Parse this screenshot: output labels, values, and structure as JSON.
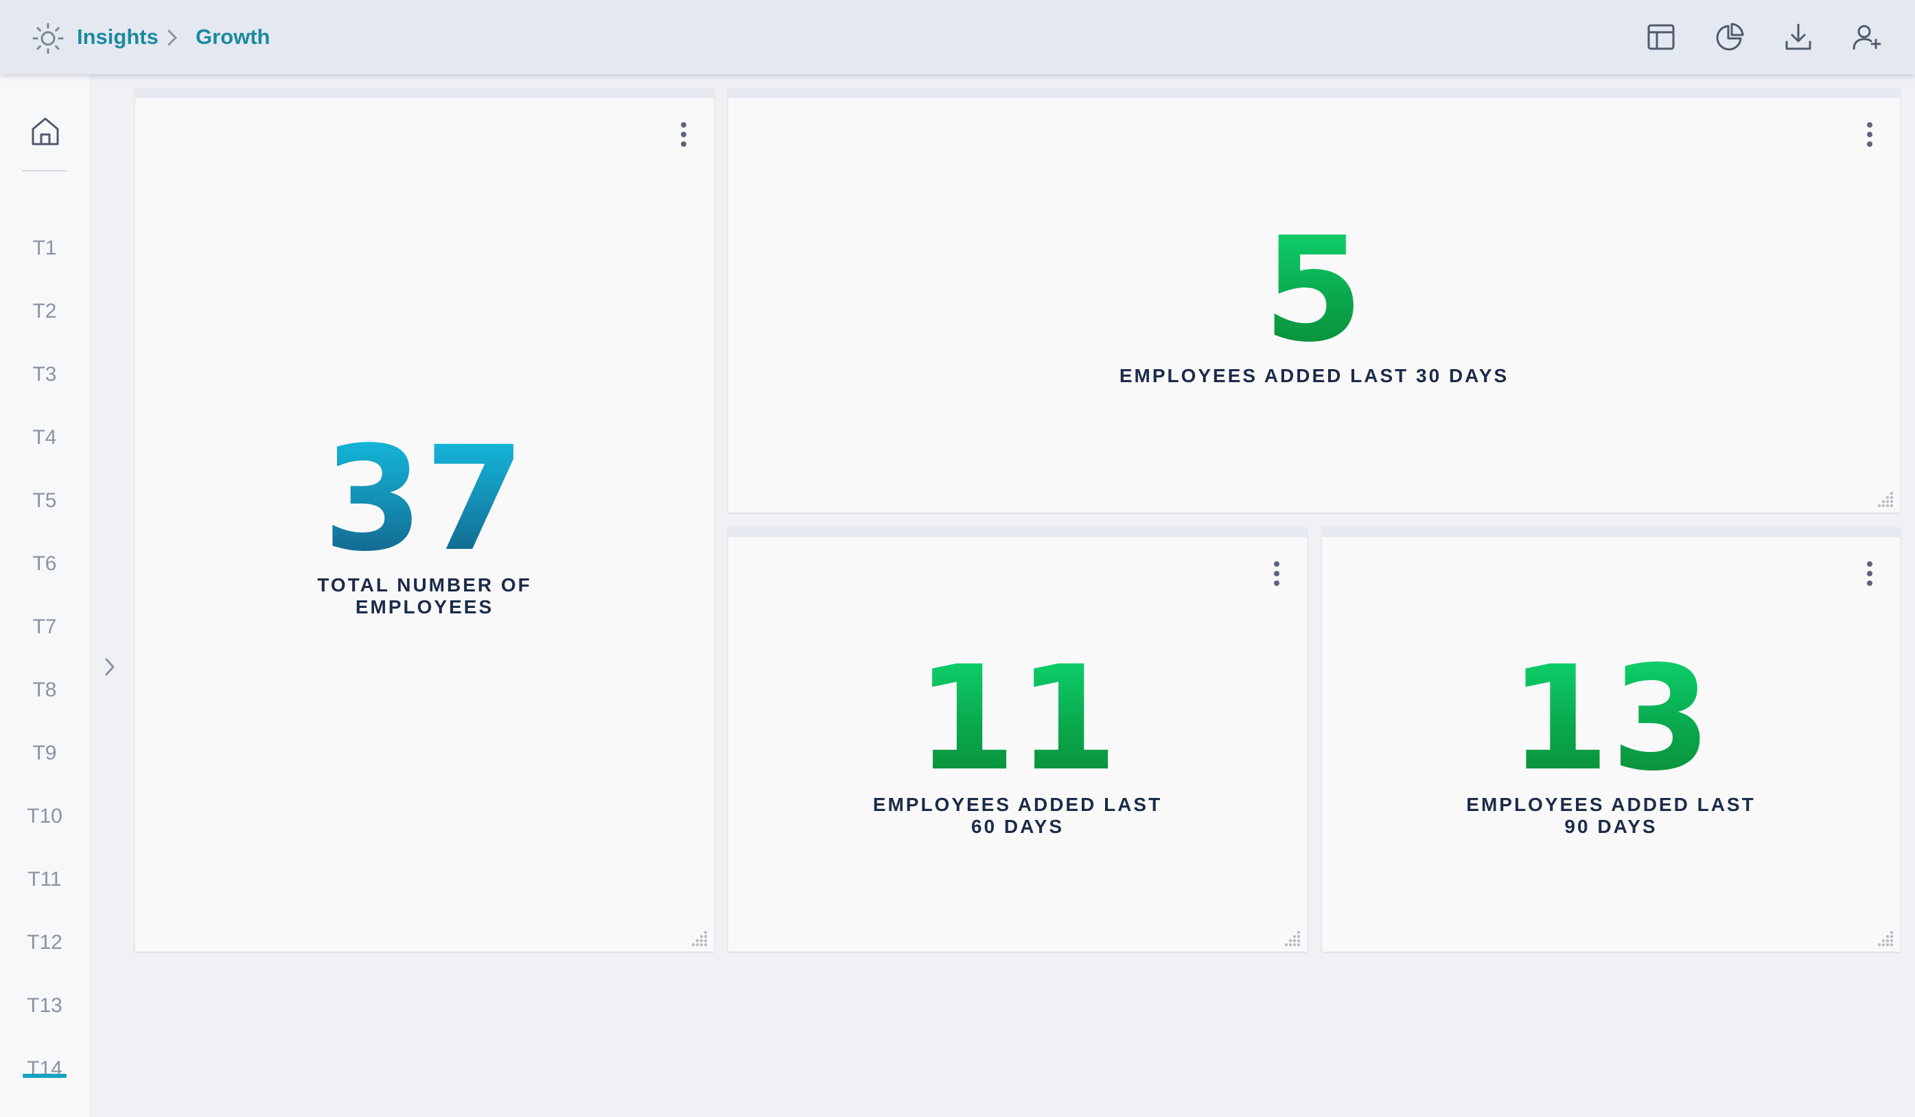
{
  "app": {
    "breadcrumb": [
      "Insights",
      "Growth"
    ],
    "accent_color": "#1a8aa0"
  },
  "toolbar": {
    "icons": [
      "layout-icon",
      "pie-chart-icon",
      "download-icon",
      "add-user-icon"
    ]
  },
  "sidebar": {
    "items": [
      "T1",
      "T2",
      "T3",
      "T4",
      "T5",
      "T6",
      "T7",
      "T8",
      "T9",
      "T10",
      "T11",
      "T12",
      "T13",
      "T14"
    ],
    "active": "T14"
  },
  "cards": [
    {
      "value": "37",
      "label_line1": "TOTAL NUMBER OF",
      "label_line2": "EMPLOYEES",
      "color": "#1490b6"
    },
    {
      "value": "5",
      "label_line1": "EMPLOYEES ADDED LAST 30 DAYS",
      "color": "#0ab85a"
    },
    {
      "value": "11",
      "label_line1": "EMPLOYEES ADDED LAST",
      "label_line2": "60 DAYS",
      "color": "#0ab85a"
    },
    {
      "value": "13",
      "label_line1": "EMPLOYEES ADDED LAST",
      "label_line2": "90 DAYS",
      "color": "#0ab85a"
    }
  ]
}
